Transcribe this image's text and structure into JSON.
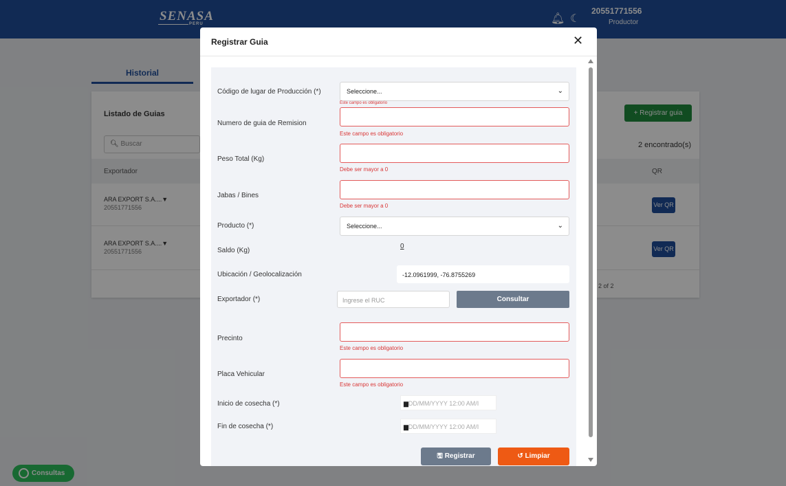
{
  "header": {
    "logo": "SENASA",
    "logo_sub": "PERU",
    "user_id": "20551771556",
    "user_role": "Productor"
  },
  "page": {
    "tab": "Historial",
    "title": "Listado de Guias",
    "add_button": "+ Registrar guia",
    "search_placeholder": "Buscar",
    "found": "2 encontrado(s)",
    "col_exportador": "Exportador",
    "col_qr": "QR",
    "rows": [
      {
        "name": "ARA EXPORT S.A....▼",
        "ruc": "20551771556",
        "qr": "Ver QR"
      },
      {
        "name": "ARA EXPORT S.A....▼",
        "ruc": "20551771556",
        "qr": "Ver QR"
      }
    ],
    "pager": "2 of 2"
  },
  "whatsapp": "Consultas",
  "modal": {
    "title": "Registrar Guia",
    "close": "✕",
    "labels": {
      "codigo": "Código de lugar de Producción (*)",
      "guia": "Numero de guia de Remision",
      "peso": "Peso Total (Kg)",
      "jabas": "Jabas / Bines",
      "producto": "Producto (*)",
      "saldo": "Saldo (Kg)",
      "ubicacion": "Ubicación / Geolocalización",
      "exportador": "Exportador (*)",
      "precinto": "Precinto",
      "placa": "Placa Vehicular",
      "inicio": "Inicio de cosecha (*)",
      "fin": "Fin de cosecha (*)"
    },
    "select_placeholder": "Seleccione...",
    "errors": {
      "required": "Este campo es obligatorio",
      "gt_zero": "Debe ser mayor a 0"
    },
    "saldo_value": "0",
    "ubicacion_value": "-12.0961999, -76.8755269",
    "ruc_placeholder": "Ingrese el RUC",
    "consultar": "Consultar",
    "date_placeholder": "DD/MM/YYYY 12:00 AM/I",
    "registrar": "Registrar",
    "limpiar": "Limpiar"
  }
}
